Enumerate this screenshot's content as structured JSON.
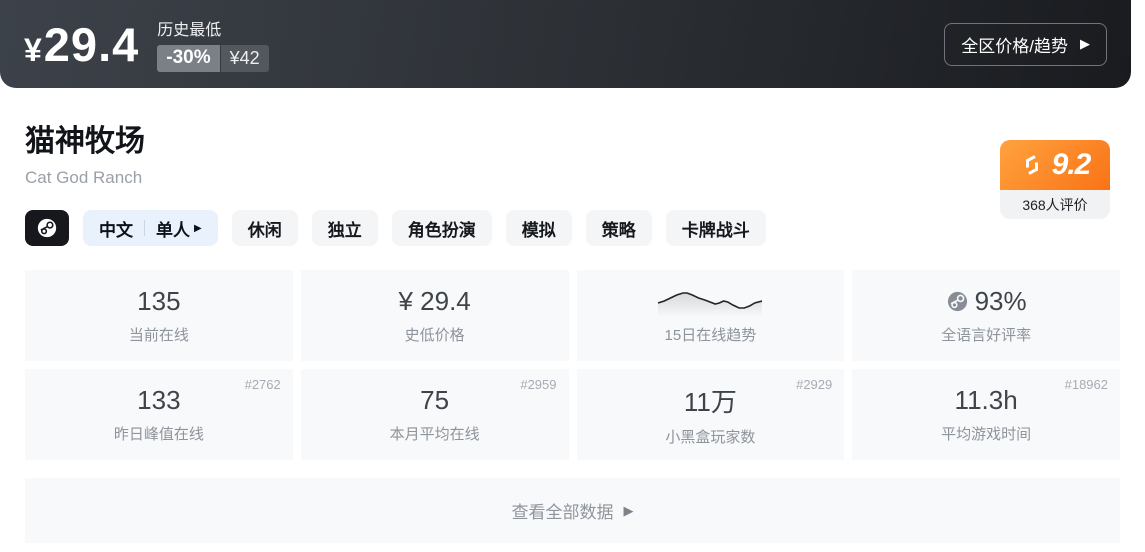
{
  "colors": {
    "bar_dark_left": "#3d424a",
    "bar_dark_right": "#191b1f",
    "accent_orange": "#f97316",
    "tag_blue_bg": "#e9f1fc",
    "tag_gray_bg": "#f4f5f7",
    "cell_bg": "#f8f9fb"
  },
  "icons": {
    "steam": "steam-logo",
    "heybox": "heybox-logo",
    "chevron_right": "▶"
  },
  "price_bar": {
    "currency": "¥",
    "amount": "29.4",
    "label": "历史最低",
    "discount": "-30%",
    "original_price": "¥42",
    "button_label": "全区价格/趋势"
  },
  "header": {
    "title": "猫神牧场",
    "subtitle": "Cat God Ranch"
  },
  "rating": {
    "score": "9.2",
    "count": "368人评价"
  },
  "tags": {
    "language": "中文",
    "mode": "单人",
    "others": [
      "休闲",
      "独立",
      "角色扮演",
      "模拟",
      "策略",
      "卡牌战斗"
    ]
  },
  "stats": {
    "cells": [
      {
        "value": "135",
        "label": "当前在线"
      },
      {
        "value": "¥ 29.4",
        "label": "史低价格"
      },
      {
        "value": "",
        "label": "15日在线趋势"
      },
      {
        "value": "93%",
        "label": "全语言好评率"
      },
      {
        "value": "133",
        "label": "昨日峰值在线",
        "rank": "#2762"
      },
      {
        "value": "75",
        "label": "本月平均在线",
        "rank": "#2959"
      },
      {
        "value": "11万",
        "label": "小黑盒玩家数",
        "rank": "#2929"
      },
      {
        "value": "11.3h",
        "label": "平均游戏时间",
        "rank": "#18962"
      }
    ],
    "sparkline": {
      "points": [
        [
          0,
          16
        ],
        [
          6,
          14
        ],
        [
          12,
          11
        ],
        [
          18,
          8
        ],
        [
          24,
          6
        ],
        [
          28,
          6
        ],
        [
          33,
          8
        ],
        [
          39,
          11
        ],
        [
          45,
          13
        ],
        [
          50,
          15
        ],
        [
          55,
          17
        ],
        [
          59,
          16
        ],
        [
          63,
          14
        ],
        [
          67,
          15
        ],
        [
          72,
          18
        ],
        [
          78,
          21
        ],
        [
          83,
          21
        ],
        [
          88,
          19
        ],
        [
          93,
          16
        ],
        [
          100,
          14
        ]
      ]
    }
  },
  "footer": {
    "view_all": "查看全部数据"
  }
}
